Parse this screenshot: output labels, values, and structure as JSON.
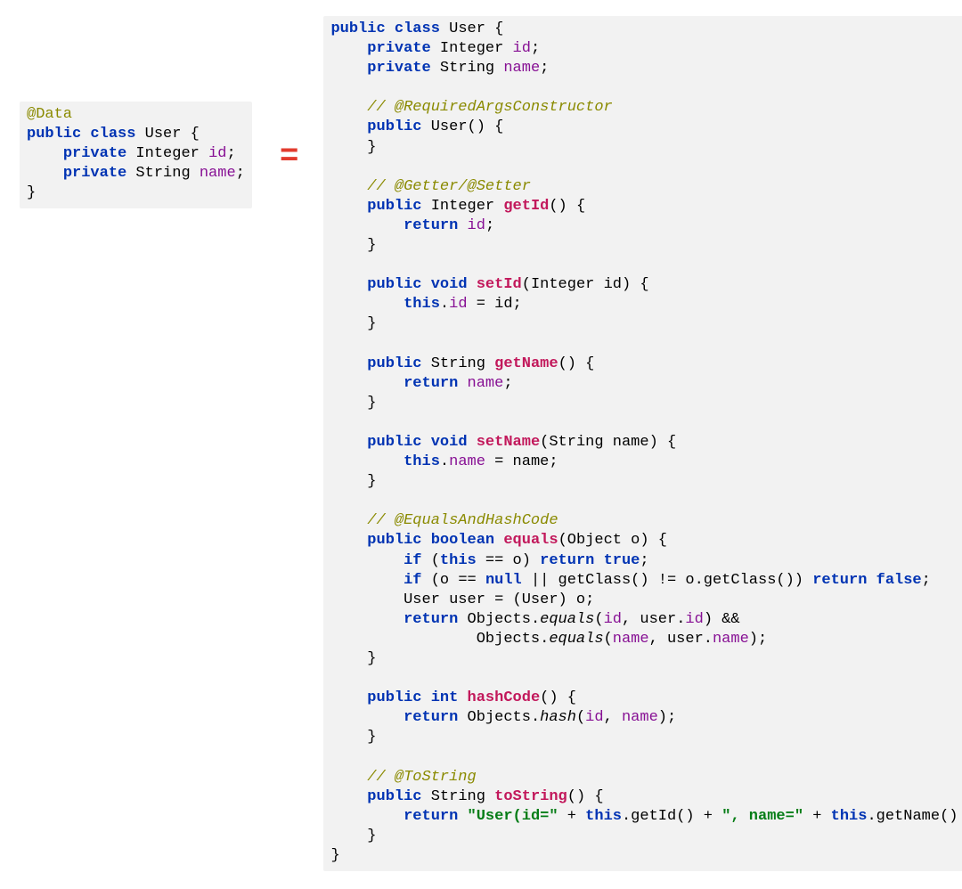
{
  "left": {
    "l1": "@Data",
    "l2a": "public",
    "l2b": "class",
    "l2c": " User {",
    "l3a": "    ",
    "l3b": "private",
    "l3c": " Integer ",
    "l3d": "id",
    "l3e": ";",
    "l4a": "    ",
    "l4b": "private",
    "l4c": " String ",
    "l4d": "name",
    "l4e": ";",
    "l5": "}"
  },
  "equals": "=",
  "right": {
    "r1a": "public",
    "r1b": "class",
    "r1c": " User {",
    "r2a": "    ",
    "r2b": "private",
    "r2c": " Integer ",
    "r2d": "id",
    "r2e": ";",
    "r3a": "    ",
    "r3b": "private",
    "r3c": " String ",
    "r3d": "name",
    "r3e": ";",
    "r4": "",
    "r5": "    // @RequiredArgsConstructor",
    "r6a": "    ",
    "r6b": "public",
    "r6c": " User() {",
    "r7": "    }",
    "r8": "",
    "r9": "    // @Getter/@Setter",
    "r10a": "    ",
    "r10b": "public",
    "r10c": " Integer ",
    "r10d": "getId",
    "r10e": "() {",
    "r11a": "        ",
    "r11b": "return",
    "r11c": " ",
    "r11d": "id",
    "r11e": ";",
    "r12": "    }",
    "r13": "",
    "r14a": "    ",
    "r14b": "public",
    "r14c": " ",
    "r14d": "void",
    "r14e": " ",
    "r14f": "setId",
    "r14g": "(Integer id) {",
    "r15a": "        ",
    "r15b": "this",
    "r15c": ".",
    "r15d": "id",
    "r15e": " = id;",
    "r16": "    }",
    "r17": "",
    "r18a": "    ",
    "r18b": "public",
    "r18c": " String ",
    "r18d": "getName",
    "r18e": "() {",
    "r19a": "        ",
    "r19b": "return",
    "r19c": " ",
    "r19d": "name",
    "r19e": ";",
    "r20": "    }",
    "r21": "",
    "r22a": "    ",
    "r22b": "public",
    "r22c": " ",
    "r22d": "void",
    "r22e": " ",
    "r22f": "setName",
    "r22g": "(String name) {",
    "r23a": "        ",
    "r23b": "this",
    "r23c": ".",
    "r23d": "name",
    "r23e": " = name;",
    "r24": "    }",
    "r25": "",
    "r26": "    // @EqualsAndHashCode",
    "r27a": "    ",
    "r27b": "public",
    "r27c": " ",
    "r27d": "boolean",
    "r27e": " ",
    "r27f": "equals",
    "r27g": "(Object o) {",
    "r28a": "        ",
    "r28b": "if",
    "r28c": " (",
    "r28d": "this",
    "r28e": " == o) ",
    "r28f": "return",
    "r28g": " ",
    "r28h": "true",
    "r28i": ";",
    "r29a": "        ",
    "r29b": "if",
    "r29c": " (o == ",
    "r29d": "null",
    "r29e": " || getClass() != o.getClass()) ",
    "r29f": "return",
    "r29g": " ",
    "r29h": "false",
    "r29i": ";",
    "r30": "        User user = (User) o;",
    "r31a": "        ",
    "r31b": "return",
    "r31c": " Objects.",
    "r31d": "equals",
    "r31e": "(",
    "r31f": "id",
    "r31g": ", user.",
    "r31h": "id",
    "r31i": ") &&",
    "r32a": "                Objects.",
    "r32b": "equals",
    "r32c": "(",
    "r32d": "name",
    "r32e": ", user.",
    "r32f": "name",
    "r32g": ");",
    "r33": "    }",
    "r34": "",
    "r35a": "    ",
    "r35b": "public",
    "r35c": " ",
    "r35d": "int",
    "r35e": " ",
    "r35f": "hashCode",
    "r35g": "() {",
    "r36a": "        ",
    "r36b": "return",
    "r36c": " Objects.",
    "r36d": "hash",
    "r36e": "(",
    "r36f": "id",
    "r36g": ", ",
    "r36h": "name",
    "r36i": ");",
    "r37": "    }",
    "r38": "",
    "r39": "    // @ToString",
    "r40a": "    ",
    "r40b": "public",
    "r40c": " String ",
    "r40d": "toString",
    "r40e": "() {",
    "r41a": "        ",
    "r41b": "return",
    "r41c": " ",
    "r41d": "\"User(id=\"",
    "r41e": " + ",
    "r41f": "this",
    "r41g": ".getId() + ",
    "r41h": "\", name=\"",
    "r41i": " + ",
    "r41j": "this",
    "r41k": ".getName() + ",
    "r41l": "\")\"",
    "r41m": ";",
    "r42": "    }",
    "r43": "}"
  }
}
